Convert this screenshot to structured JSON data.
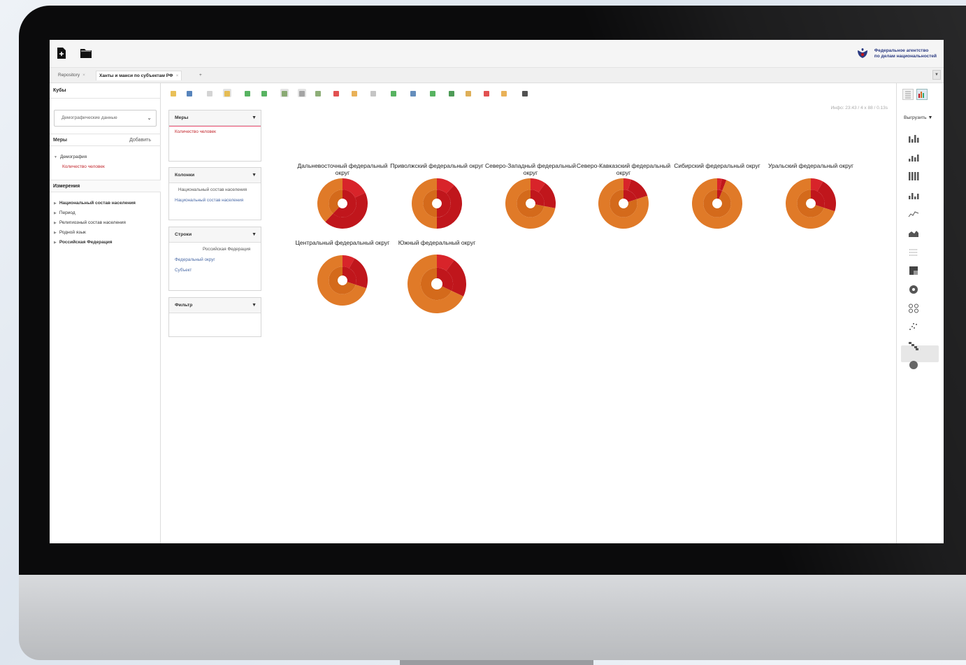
{
  "app": {
    "brand": {
      "line1": "Федеральное агентство",
      "line2": "по делам национальностей"
    },
    "emblem_icon": "eagle-emblem-icon"
  },
  "tabs": [
    {
      "label": "Repository",
      "active": false
    },
    {
      "label": "Ханты и манси по субъектам РФ",
      "active": true
    },
    {
      "label": "+",
      "active": false
    }
  ],
  "left": {
    "cubes_title": "Кубы",
    "cube_selected": "Демографические данные",
    "measures_title": "Меры",
    "add_label": "Добавить",
    "measures_tree": {
      "group": "Демография",
      "item": "Количество человек"
    },
    "dimensions_title": "Измерения",
    "dimensions": [
      {
        "label": "Национальный состав населения",
        "bold": true
      },
      {
        "label": "Период",
        "bold": false
      },
      {
        "label": "Религиозный состав населения",
        "bold": false
      },
      {
        "label": "Родной язык",
        "bold": false
      },
      {
        "label": "Российская Федерация",
        "bold": true
      }
    ]
  },
  "query": {
    "measures": {
      "title": "Меры",
      "items": [
        "Количество человек"
      ]
    },
    "columns": {
      "title": "Колонки",
      "items": [
        "Национальный состав населения",
        "Национальный состав населения"
      ]
    },
    "rows": {
      "title": "Строки",
      "items": [
        "Российская Федерация",
        "Федеральный округ",
        "Субъект"
      ]
    },
    "filter": {
      "title": "Фильтр",
      "items": []
    }
  },
  "info_text": "Инфо: 23:43  /  4 x 88  /  0.13s",
  "right": {
    "export_label": "Выгрузить"
  },
  "colors": {
    "dark_red": "#c0161c",
    "red": "#d8242a",
    "orange": "#d46a1b",
    "light_orange": "#e07a28",
    "brand_blue": "#2a3a82"
  },
  "chart_data": {
    "type": "pie",
    "subtype": "multi-level donut",
    "charts": [
      {
        "title": "Дальневосточный федеральный округ",
        "inner": [
          0.62,
          0.38
        ],
        "outer": [
          0.18,
          0.44,
          0.38
        ]
      },
      {
        "title": "Приволжский федеральный округ",
        "inner": [
          0.5,
          0.5
        ],
        "outer": [
          0.12,
          0.38,
          0.5
        ]
      },
      {
        "title": "Северо-Западный федеральный округ",
        "inner": [
          0.28,
          0.72
        ],
        "outer": [
          0.1,
          0.18,
          0.72
        ]
      },
      {
        "title": "Северо-Кавказский федеральный округ",
        "inner": [
          0.2,
          0.8
        ],
        "outer": [
          0.05,
          0.15,
          0.8
        ]
      },
      {
        "title": "Сибирский федеральный округ",
        "inner": [
          0.06,
          0.94
        ],
        "outer": [
          0.03,
          0.03,
          0.94
        ]
      },
      {
        "title": "Уральский федеральный округ",
        "inner": [
          0.3,
          0.7
        ],
        "outer": [
          0.08,
          0.22,
          0.7
        ]
      },
      {
        "title": "Центральный федеральный округ",
        "inner": [
          0.3,
          0.7
        ],
        "outer": [
          0.08,
          0.22,
          0.7
        ]
      },
      {
        "title": "Южный федеральный округ",
        "inner": [
          0.32,
          0.68
        ],
        "outer": [
          0.1,
          0.22,
          0.68
        ]
      }
    ]
  }
}
